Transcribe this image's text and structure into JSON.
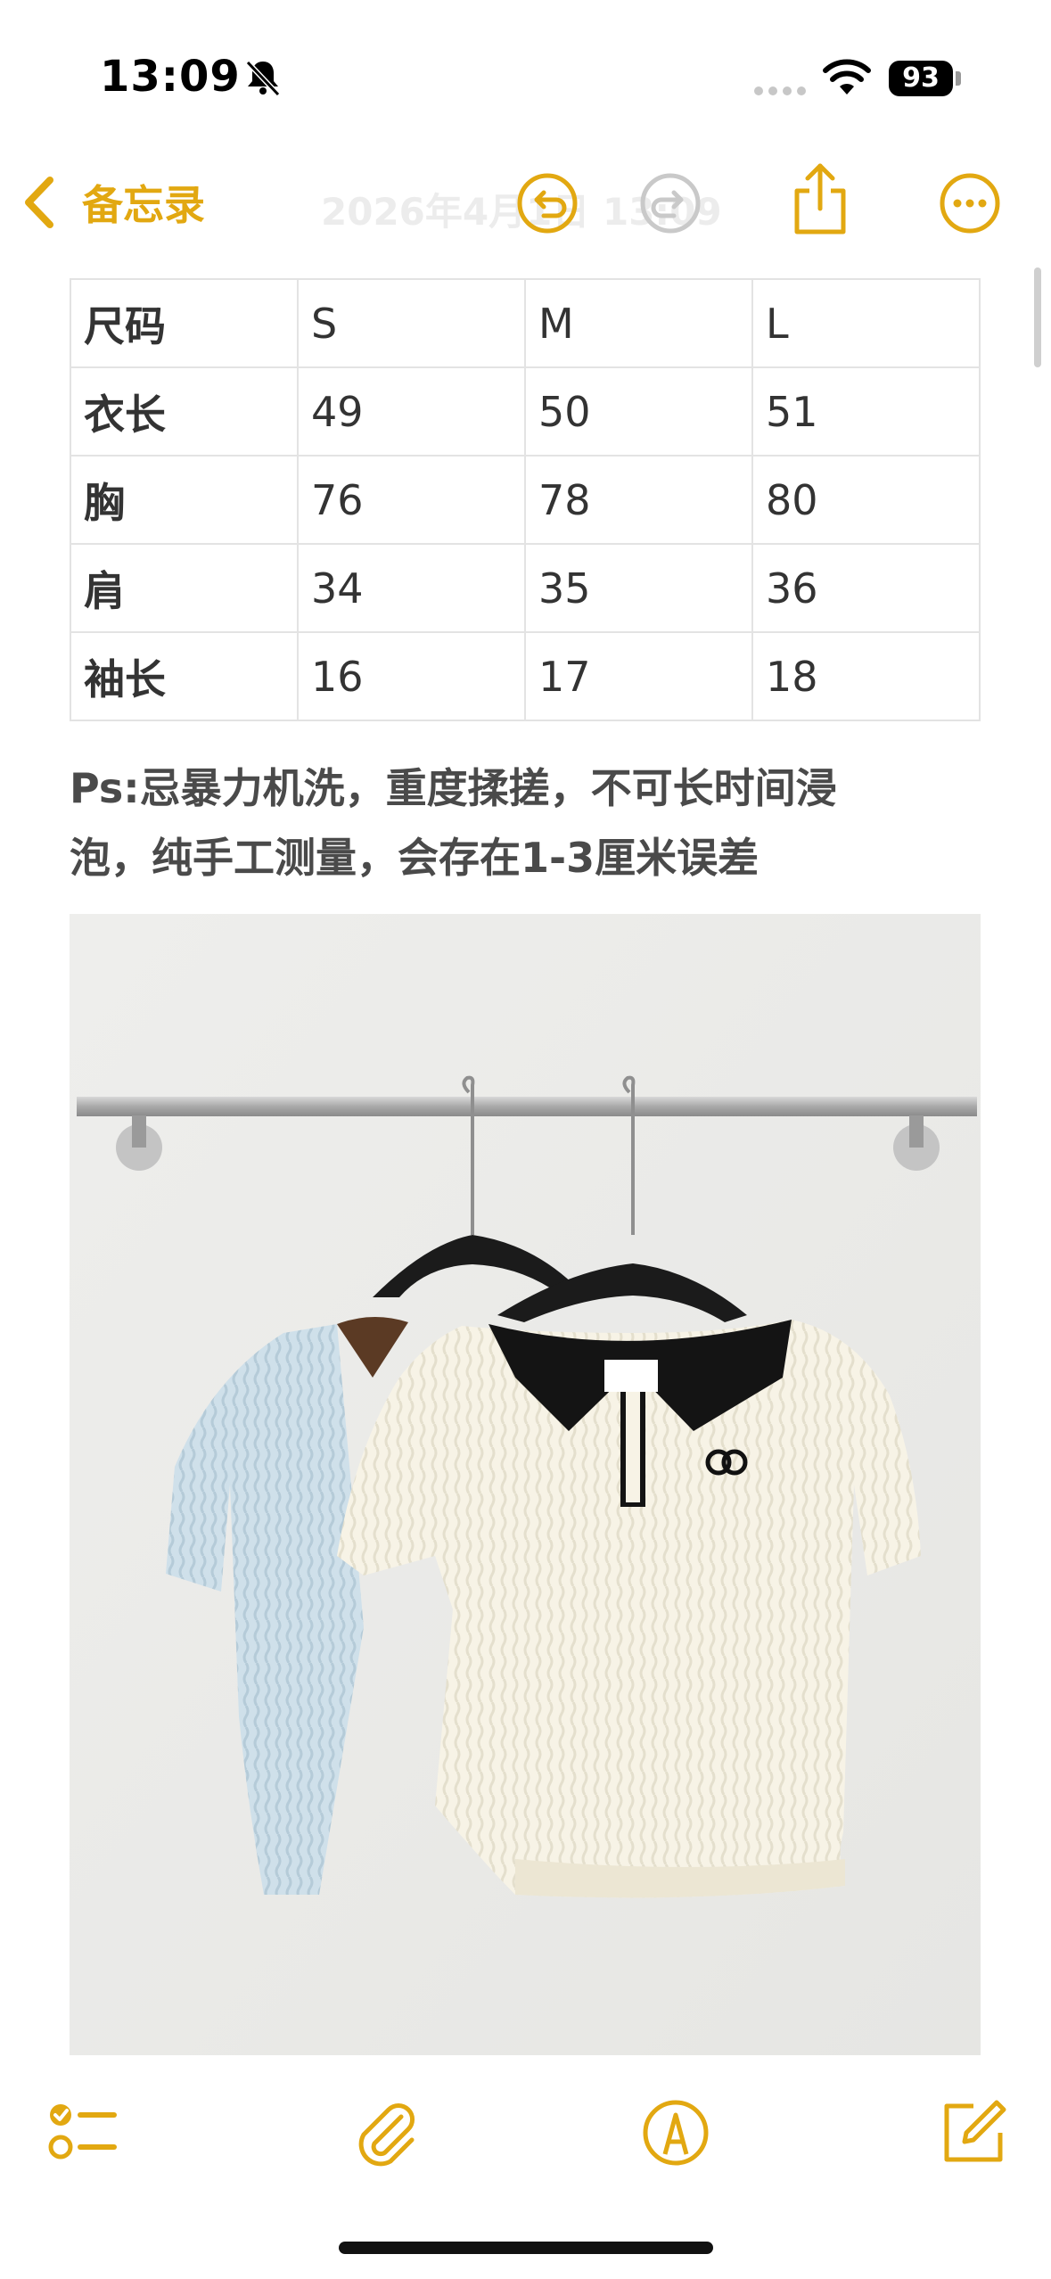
{
  "status_bar": {
    "time": "13:09",
    "battery": "93",
    "icons": [
      "bell-slash-icon",
      "cellular-signal-icon",
      "wifi-icon",
      "battery-icon"
    ]
  },
  "nav": {
    "back_label": "备忘录",
    "date_title": "2026年4月1日 13:09",
    "icons": [
      "chevron-left-icon",
      "undo-icon",
      "redo-icon",
      "share-icon",
      "more-icon"
    ],
    "accent_color": "#e2a811"
  },
  "size_table": {
    "rows": [
      [
        "尺码",
        "S",
        "M",
        "L"
      ],
      [
        "衣长",
        "49",
        "50",
        "51"
      ],
      [
        "胸",
        "76",
        "78",
        "80"
      ],
      [
        "肩",
        "34",
        "35",
        "36"
      ],
      [
        "袖长",
        "16",
        "17",
        "18"
      ]
    ]
  },
  "note": {
    "line1": "Ps:忌暴力机洗，重度揉搓，不可长时间浸",
    "line2": "泡，纯手工测量，会存在1-3厘米误差"
  },
  "toolbar": {
    "icons": [
      "checklist-icon",
      "paperclip-icon",
      "markup-pen-icon",
      "compose-icon"
    ]
  }
}
